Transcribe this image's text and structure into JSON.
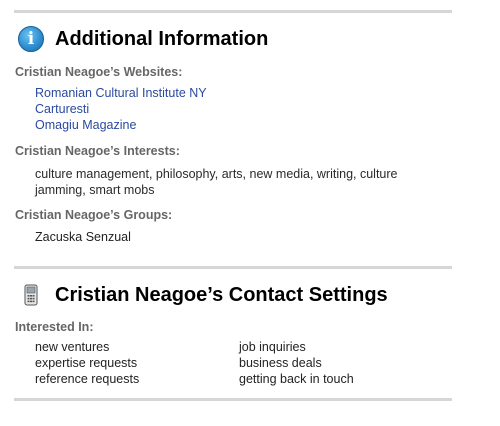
{
  "additional_info": {
    "title": "Additional Information",
    "websites_label": "Cristian Neagoe’s Websites:",
    "websites": [
      "Romanian Cultural Institute NY",
      "Carturesti",
      "Omagiu Magazine"
    ],
    "interests_label": "Cristian Neagoe’s Interests:",
    "interests": [
      "culture management",
      "philosophy",
      "arts",
      "new media",
      "writing",
      "culture jamming",
      "smart mobs"
    ],
    "groups_label": "Cristian Neagoe’s Groups:",
    "groups": [
      "Zacuska Senzual"
    ]
  },
  "contact_settings": {
    "title": "Cristian Neagoe’s Contact Settings",
    "interested_in_label": "Interested In:",
    "left_column": [
      "new ventures",
      "expertise requests",
      "reference requests"
    ],
    "right_column": [
      "job inquiries",
      "business deals",
      "getting back in touch"
    ]
  },
  "icons": {
    "info": "info-icon",
    "contact": "phone-icon"
  },
  "colors": {
    "link": "#2a4a9e",
    "label": "#666666",
    "rule": "#d6d6d6",
    "info_icon": "#2f8fd0"
  }
}
